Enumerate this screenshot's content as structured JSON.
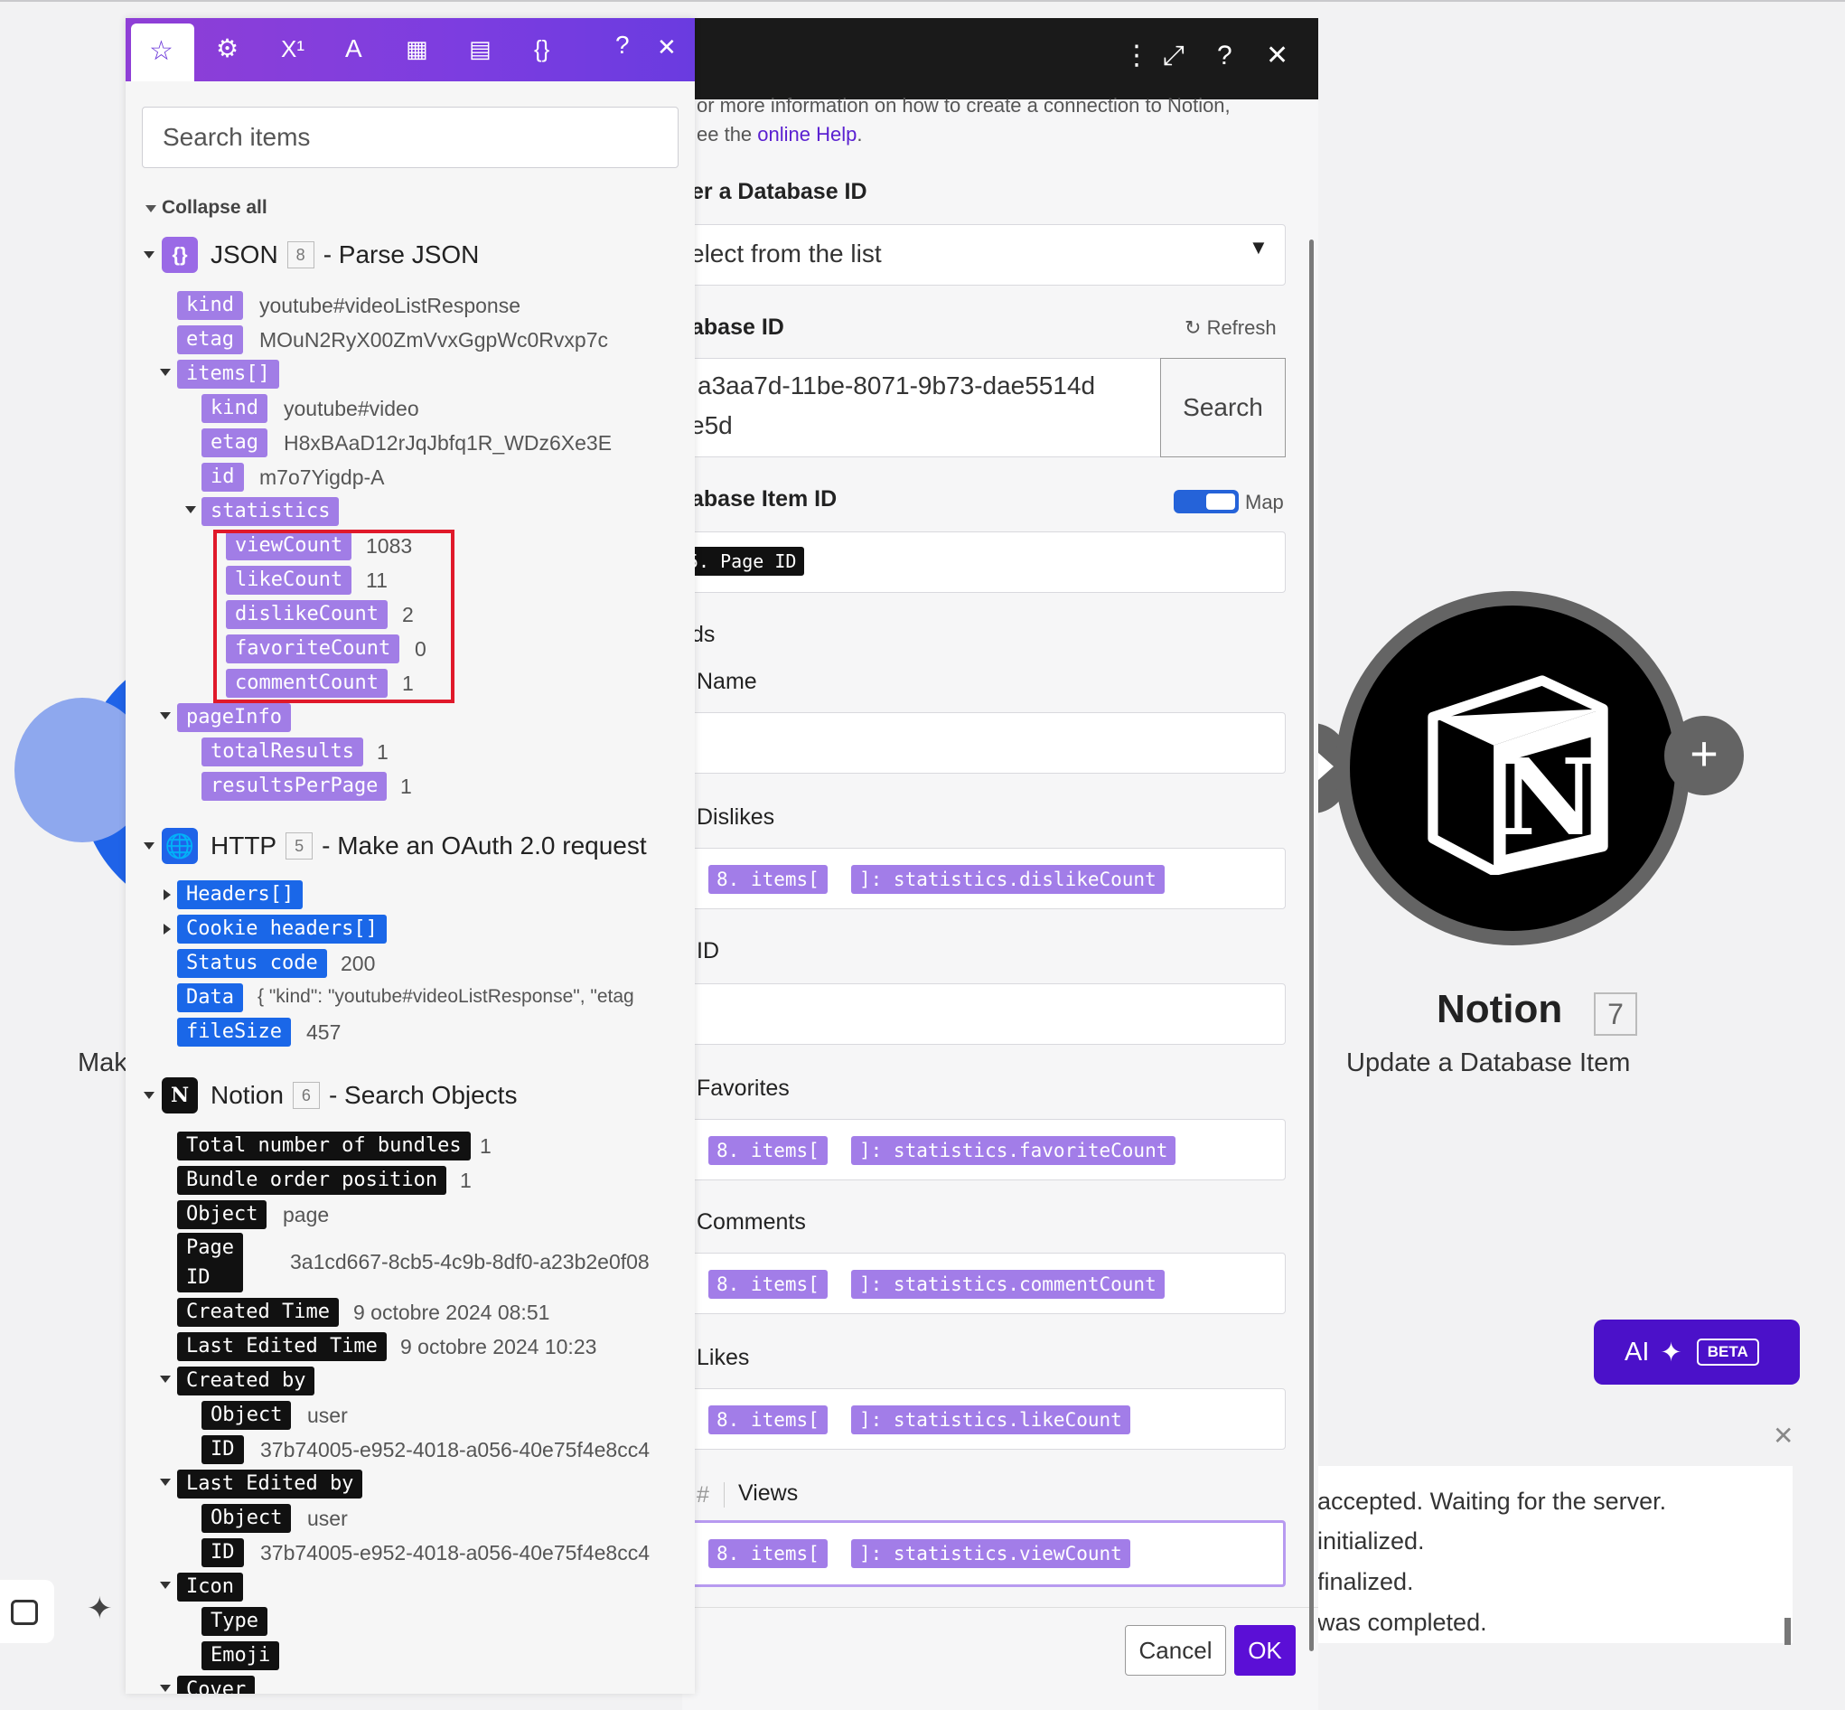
{
  "background": {
    "partial_label": "Mak",
    "notion_module": {
      "title": "Notion",
      "number": "7",
      "subtitle": "Update a Database Item"
    },
    "ai_button": {
      "label": "AI",
      "badge": "BETA"
    },
    "log": [
      "accepted. Waiting for the server.",
      "initialized.",
      "finalized.",
      "was completed."
    ]
  },
  "dialog": {
    "help_line1": "or more information on how to create a connection to Notion,",
    "help_line2_prefix": "ee the ",
    "help_link": "online Help",
    "help_line2_suffix": ".",
    "enter_db_label": "er a Database ID",
    "select_value": "elect from the list",
    "db_id_label": "abase ID",
    "refresh_label": "Refresh",
    "db_id_value_line1": "a3aa7d-11be-8071-9b73-dae5514d",
    "db_id_value_line2": "e5d",
    "search_button": "Search",
    "item_id_label": "abase Item ID",
    "map_label": "Map",
    "item_id_chip": "5. Page ID",
    "fields_label": "ds",
    "name_label": "Name",
    "dislikes_label": "Dislikes",
    "dislikes_chip_a": "8. items[",
    "dislikes_chip_b": "]: statistics.dislikeCount",
    "id_label": "ID",
    "favorites_label": "Favorites",
    "favorites_chip_a": "8. items[",
    "favorites_chip_b": "]: statistics.favoriteCount",
    "comments_label": "Comments",
    "comments_chip_a": "8. items[",
    "comments_chip_b": "]: statistics.commentCount",
    "likes_label": "Likes",
    "likes_chip_a": "8. items[",
    "likes_chip_b": "]: statistics.likeCount",
    "views_hash": "#",
    "views_label": "Views",
    "views_chip_a": "8. items[",
    "views_chip_b": "]: statistics.viewCount",
    "cancel_button": "Cancel",
    "ok_button": "OK"
  },
  "panel": {
    "search_placeholder": "Search items",
    "collapse_all": "Collapse all",
    "json_module": {
      "name": "JSON",
      "num": "8",
      "desc": "- Parse JSON"
    },
    "json_items": {
      "kind_key": "kind",
      "kind_val": "youtube#videoListResponse",
      "etag_key": "etag",
      "etag_val": "MOuN2RyX00ZmVvxGgpWc0Rvxp7c",
      "items_key": "items[]",
      "item_kind_key": "kind",
      "item_kind_val": "youtube#video",
      "item_etag_key": "etag",
      "item_etag_val": "H8xBAaD12rJqJbfq1R_WDz6Xe3E",
      "item_id_key": "id",
      "item_id_val": "m7o7Yigdp-A",
      "statistics_key": "statistics",
      "viewCount_key": "viewCount",
      "viewCount_val": "1083",
      "likeCount_key": "likeCount",
      "likeCount_val": "11",
      "dislikeCount_key": "dislikeCount",
      "dislikeCount_val": "2",
      "favoriteCount_key": "favoriteCount",
      "favoriteCount_val": "0",
      "commentCount_key": "commentCount",
      "commentCount_val": "1",
      "pageInfo_key": "pageInfo",
      "totalResults_key": "totalResults",
      "totalResults_val": "1",
      "resultsPerPage_key": "resultsPerPage",
      "resultsPerPage_val": "1"
    },
    "http_module": {
      "name": "HTTP",
      "num": "5",
      "desc": "- Make an OAuth 2.0 request"
    },
    "http_items": {
      "headers_key": "Headers[]",
      "cookie_key": "Cookie headers[]",
      "status_key": "Status code",
      "status_val": "200",
      "data_key": "Data",
      "data_val": "{ \"kind\": \"youtube#videoListResponse\", \"etag",
      "filesize_key": "fileSize",
      "filesize_val": "457"
    },
    "notion_module": {
      "name": "Notion",
      "num": "6",
      "desc": "- Search Objects"
    },
    "notion_items": {
      "total_key": "Total number of bundles",
      "total_val": "1",
      "order_key": "Bundle order position",
      "order_val": "1",
      "object_key": "Object",
      "object_val": "page",
      "pageid_key1": "Page",
      "pageid_key2": "ID",
      "pageid_val": "3a1cd667-8cb5-4c9b-8df0-a23b2e0f08",
      "created_time_key": "Created Time",
      "created_time_val": "9 octobre 2024 08:51",
      "edited_time_key": "Last Edited Time",
      "edited_time_val": "9 octobre 2024 10:23",
      "created_by_key": "Created by",
      "cb_object_key": "Object",
      "cb_object_val": "user",
      "cb_id_key": "ID",
      "cb_id_val": "37b74005-e952-4018-a056-40e75f4e8cc4",
      "edited_by_key": "Last Edited by",
      "eb_object_key": "Object",
      "eb_object_val": "user",
      "eb_id_key": "ID",
      "eb_id_val": "37b74005-e952-4018-a056-40e75f4e8cc4",
      "icon_key": "Icon",
      "type_key": "Type",
      "emoji_key": "Emoji",
      "cover_key": "Cover"
    }
  }
}
